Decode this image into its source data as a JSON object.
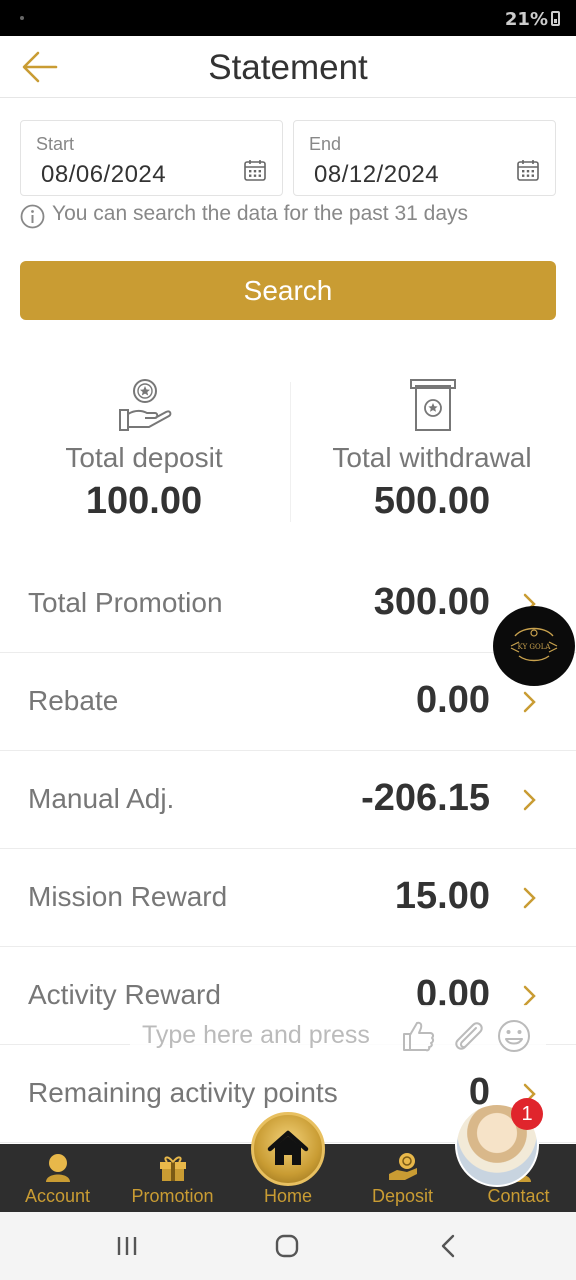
{
  "status_bar": {
    "battery": "21%"
  },
  "header": {
    "title": "Statement"
  },
  "date_range": {
    "start": {
      "label": "Start",
      "value": "08/06/2024"
    },
    "end": {
      "label": "End",
      "value": "08/12/2024"
    },
    "hint": "You can search the data for the past 31 days"
  },
  "search_button": "Search",
  "totals": {
    "deposit": {
      "label": "Total deposit",
      "value": "100.00"
    },
    "withdrawal": {
      "label": "Total withdrawal",
      "value": "500.00"
    }
  },
  "rows": [
    {
      "label": "Total Promotion",
      "value": "300.00"
    },
    {
      "label": "Rebate",
      "value": "0.00"
    },
    {
      "label": "Manual Adj.",
      "value": "-206.15"
    },
    {
      "label": "Mission Reward",
      "value": "15.00"
    },
    {
      "label": "Activity Reward",
      "value": "0.00"
    },
    {
      "label": "Remaining activity points",
      "value": "0"
    }
  ],
  "floating_logo": {
    "text": "KY GOLA"
  },
  "chat": {
    "placeholder": "Type here and press"
  },
  "bottom_nav": [
    {
      "label": "Account",
      "icon": "account-icon"
    },
    {
      "label": "Promotion",
      "icon": "gift-icon"
    },
    {
      "label": "Home",
      "icon": "home-icon"
    },
    {
      "label": "Deposit",
      "icon": "deposit-icon"
    },
    {
      "label": "Contact",
      "icon": "contact-icon"
    }
  ],
  "chat_avatar": {
    "badge": "1"
  },
  "colors": {
    "accent": "#c99c33",
    "nav_bg": "#2e2e2e",
    "badge": "#e0252c"
  }
}
